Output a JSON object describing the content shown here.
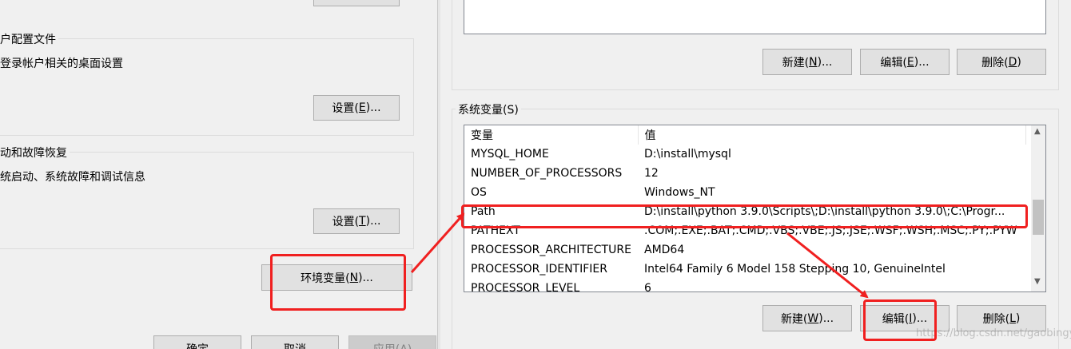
{
  "left_panel": {
    "user_profiles": {
      "title": "户配置文件",
      "description": "与登录帐户相关的桌面设置",
      "settings_button": {
        "label": "设置(",
        "hotkey": "E",
        "suffix": ")..."
      }
    },
    "startup_recovery": {
      "title": "动和故障恢复",
      "description": "系统启动、系统故障和调试信息",
      "settings_button": {
        "label": "设置(",
        "hotkey": "T",
        "suffix": ")..."
      }
    },
    "env_button": {
      "label": "环境变量(",
      "hotkey": "N",
      "suffix": ")..."
    },
    "ok_button": "确定",
    "cancel_button": "取消",
    "apply_button": "应用(A)"
  },
  "user_vars": {
    "new_button": {
      "label": "新建(",
      "hotkey": "N",
      "suffix": ")..."
    },
    "edit_button": {
      "label": "编辑(",
      "hotkey": "E",
      "suffix": ")..."
    },
    "delete_button": {
      "label": "删除(",
      "hotkey": "D",
      "suffix": ")"
    }
  },
  "system_vars": {
    "title": "系统变量(S)",
    "columns": {
      "variable": "变量",
      "value": "值"
    },
    "rows": [
      {
        "name": "MYSQL_HOME",
        "value": "D:\\install\\mysql"
      },
      {
        "name": "NUMBER_OF_PROCESSORS",
        "value": "12"
      },
      {
        "name": "OS",
        "value": "Windows_NT"
      },
      {
        "name": "Path",
        "value": "D:\\install\\python 3.9.0\\Scripts\\;D:\\install\\python 3.9.0\\;C:\\Progr..."
      },
      {
        "name": "PATHEXT",
        "value": ".COM;.EXE;.BAT;.CMD;.VBS;.VBE;.JS;.JSE;.WSF;.WSH;.MSC;.PY;.PYW"
      },
      {
        "name": "PROCESSOR_ARCHITECTURE",
        "value": "AMD64"
      },
      {
        "name": "PROCESSOR_IDENTIFIER",
        "value": "Intel64 Family 6 Model 158 Stepping 10, GenuineIntel"
      },
      {
        "name": "PROCESSOR_LEVEL",
        "value": "6"
      }
    ],
    "new_button": {
      "label": "新建(",
      "hotkey": "W",
      "suffix": ")..."
    },
    "edit_button": {
      "label": "编辑(",
      "hotkey": "I",
      "suffix": ")..."
    },
    "delete_button": {
      "label": "删除(",
      "hotkey": "L",
      "suffix": ")"
    }
  },
  "watermark": "https://blog.csdn.net/gaobingyang",
  "colors": {
    "annotation_red": "#f02020",
    "button_bg": "#e1e1e1",
    "window_bg": "#f0f0f0"
  }
}
